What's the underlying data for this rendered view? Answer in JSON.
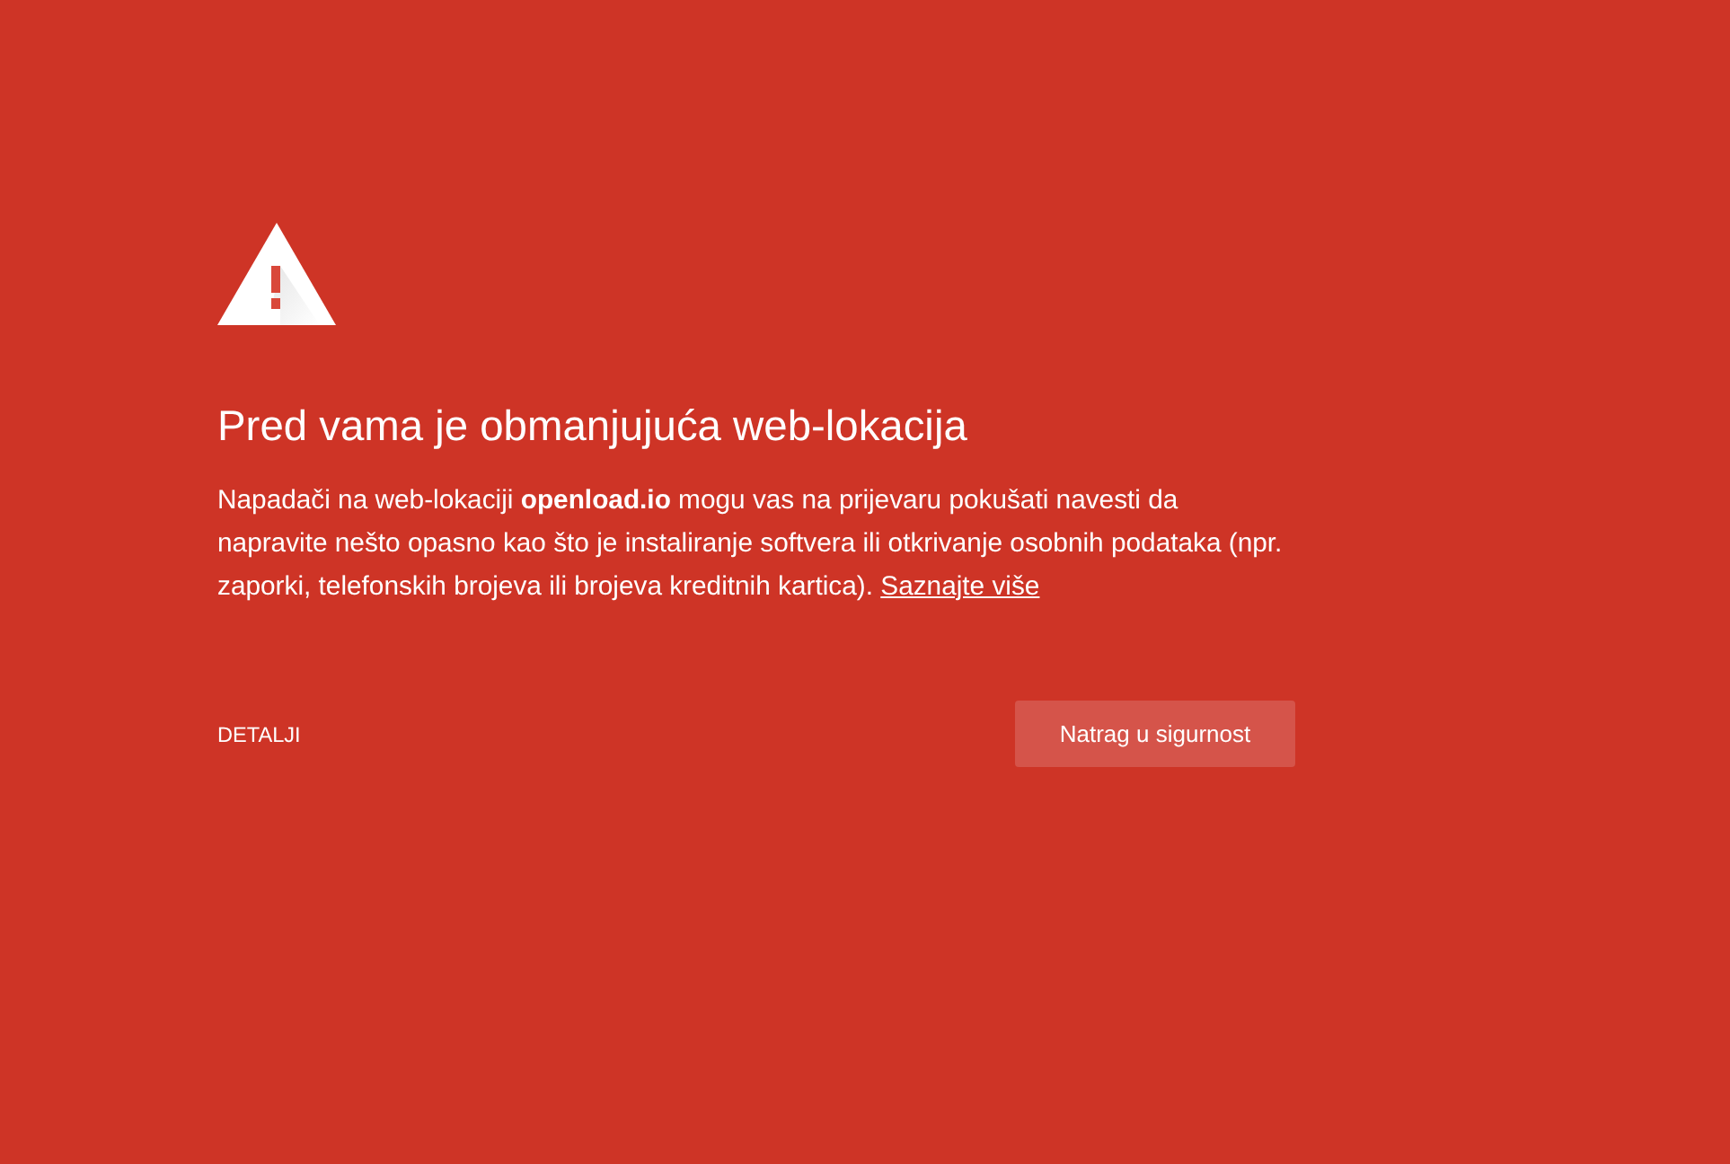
{
  "heading": "Pred vama je obmanjujuća web-lokacija",
  "message": {
    "text": "Napadači na web-lokaciji **openload.io** mogu vas na prijevaru pokušati navesti da napravite nešto opasno kao što je instaliranje softvera ili otkrivanje osobnih podataka (npr. zaporki, telefonskih brojeva ili brojeva kreditnih kartica).",
    "link": "Saznajte više"
  },
  "buttons": {
    "details": "DETALJI",
    "back": "Natrag u sigurnost"
  }
}
